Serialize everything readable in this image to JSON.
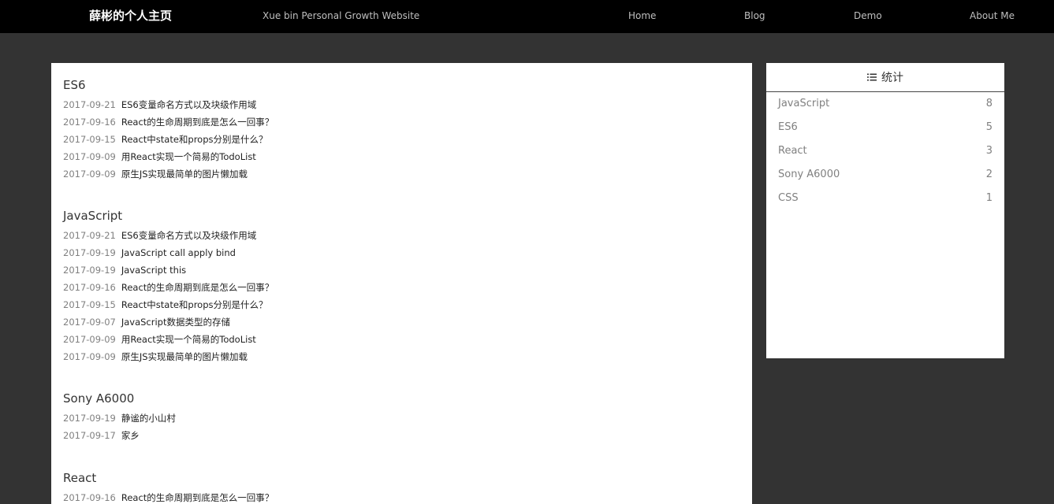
{
  "header": {
    "brand": "薛彬的个人主页",
    "subtitle": "Xue bin Personal Growth Website",
    "nav": [
      {
        "label": "Home"
      },
      {
        "label": "Blog"
      },
      {
        "label": "Demo"
      },
      {
        "label": "About Me"
      }
    ]
  },
  "main": {
    "sections": [
      {
        "title": "ES6",
        "posts": [
          {
            "date": "2017-09-21",
            "title": "ES6变量命名方式以及块级作用域"
          },
          {
            "date": "2017-09-16",
            "title": "React的生命周期到底是怎么一回事？"
          },
          {
            "date": "2017-09-15",
            "title": "React中state和props分别是什么？"
          },
          {
            "date": "2017-09-09",
            "title": "用React实现一个简易的TodoList"
          },
          {
            "date": "2017-09-09",
            "title": "原生JS实现最简单的图片懒加载"
          }
        ]
      },
      {
        "title": "JavaScript",
        "posts": [
          {
            "date": "2017-09-21",
            "title": "ES6变量命名方式以及块级作用域"
          },
          {
            "date": "2017-09-19",
            "title": "JavaScript call apply bind"
          },
          {
            "date": "2017-09-19",
            "title": "JavaScript this"
          },
          {
            "date": "2017-09-16",
            "title": "React的生命周期到底是怎么一回事？"
          },
          {
            "date": "2017-09-15",
            "title": "React中state和props分别是什么？"
          },
          {
            "date": "2017-09-07",
            "title": "JavaScript数据类型的存储"
          },
          {
            "date": "2017-09-09",
            "title": "用React实现一个简易的TodoList"
          },
          {
            "date": "2017-09-09",
            "title": "原生JS实现最简单的图片懒加载"
          }
        ]
      },
      {
        "title": "Sony A6000",
        "posts": [
          {
            "date": "2017-09-19",
            "title": "静谧的小山村"
          },
          {
            "date": "2017-09-17",
            "title": "家乡"
          }
        ]
      },
      {
        "title": "React",
        "posts": [
          {
            "date": "2017-09-16",
            "title": "React的生命周期到底是怎么一回事？"
          }
        ]
      }
    ]
  },
  "sidebar": {
    "icon": "list-icon",
    "title": "统计",
    "stats": [
      {
        "label": "JavaScript",
        "count": "8"
      },
      {
        "label": "ES6",
        "count": "5"
      },
      {
        "label": "React",
        "count": "3"
      },
      {
        "label": "Sony A6000",
        "count": "2"
      },
      {
        "label": "CSS",
        "count": "1"
      }
    ]
  }
}
